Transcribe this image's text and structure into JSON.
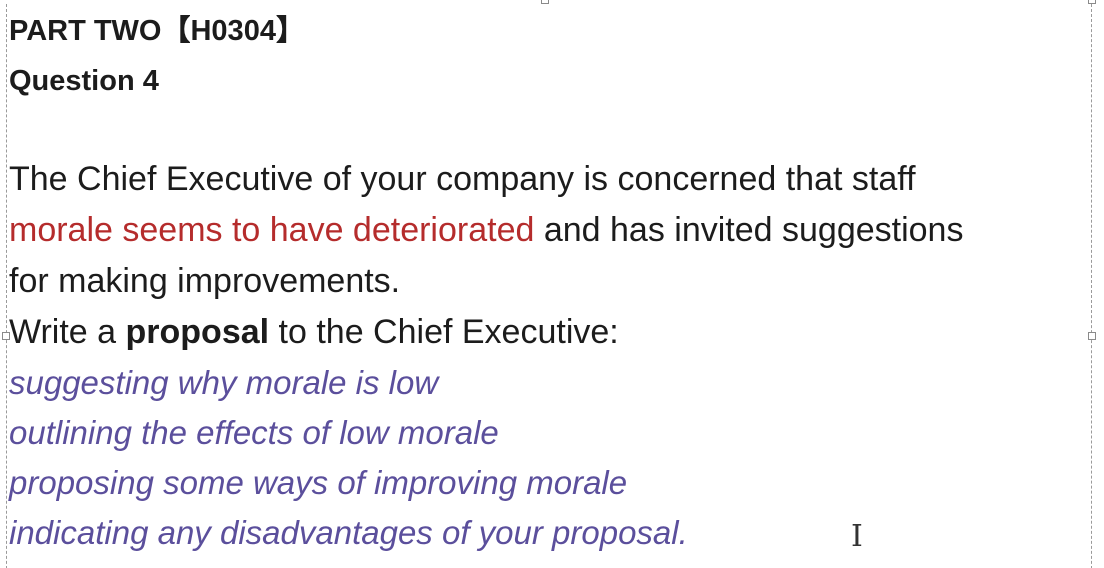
{
  "heading": {
    "part": "PART TWO【H0304】",
    "question": "Question 4"
  },
  "task": {
    "line1": "The Chief Executive of your company is concerned that staff",
    "line2_highlight": "morale seems to have deteriorated",
    "line2_rest": " and has invited suggestions",
    "line3": "for making improvements.",
    "instruction_pre": "Write a ",
    "instruction_bold": "proposal",
    "instruction_post": " to the Chief Executive:"
  },
  "bullets": [
    "suggesting why morale is low",
    "outlining the effects of low morale",
    "proposing some ways of improving morale",
    "indicating any disadvantages of your proposal."
  ],
  "cursor_glyph": "I",
  "colors": {
    "highlight_red": "#b52c2c",
    "bullet_purple": "#5b4f9c",
    "text": "#1c1c1c"
  }
}
